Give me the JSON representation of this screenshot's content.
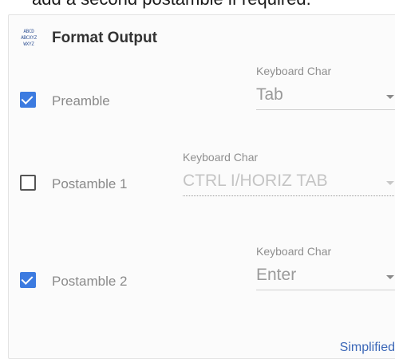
{
  "caption": "add a second postamble if required.",
  "header": {
    "icon": "text-format-icon",
    "icon_lines": [
      "ABCD",
      "ABCXYZ",
      "WXYZ"
    ],
    "title": "Format Output"
  },
  "rows": [
    {
      "label": "Preamble",
      "checked": true,
      "field_label": "Keyboard Char",
      "value": "Tab",
      "disabled": false
    },
    {
      "label": "Postamble 1",
      "checked": false,
      "field_label": "Keyboard Char",
      "value": "CTRL I/HORIZ TAB",
      "disabled": true
    },
    {
      "label": "Postamble 2",
      "checked": true,
      "field_label": "Keyboard Char",
      "value": "Enter",
      "disabled": false
    }
  ],
  "footer": {
    "link": "Simplified"
  },
  "colors": {
    "accent": "#3c7be0",
    "link": "#3b67b7"
  }
}
